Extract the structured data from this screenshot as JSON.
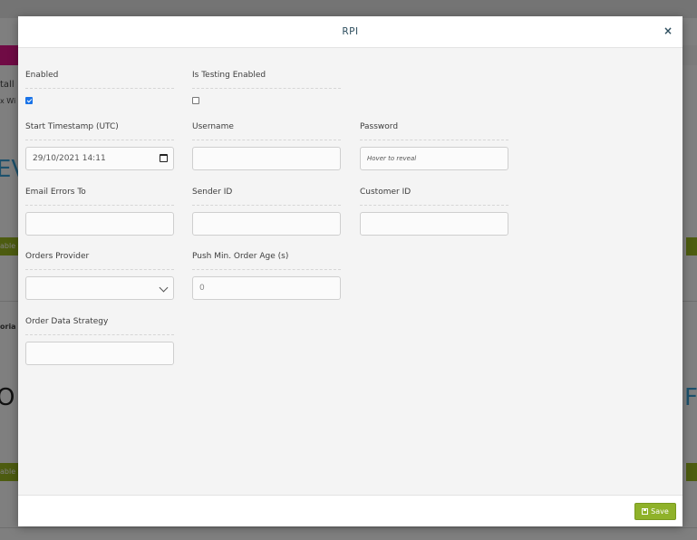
{
  "background": {
    "text_a": "tall",
    "text_b": "x Wi",
    "text_c": "oria",
    "big_left_1": "EV",
    "big_left_2": "O",
    "big_right_2": "F",
    "btn_left": "able",
    "btn_left_2": "able"
  },
  "modal": {
    "title": "RPI",
    "close_symbol": "×"
  },
  "form": {
    "enabled": {
      "label": "Enabled",
      "checked": true
    },
    "is_testing_enabled": {
      "label": "Is Testing Enabled",
      "checked": false
    },
    "start_timestamp": {
      "label": "Start Timestamp (UTC)",
      "value": "29/10/2021 14:11"
    },
    "username": {
      "label": "Username",
      "value": ""
    },
    "password": {
      "label": "Password",
      "placeholder": "Hover to reveal"
    },
    "email_errors_to": {
      "label": "Email Errors To",
      "value": ""
    },
    "sender_id": {
      "label": "Sender ID",
      "value": ""
    },
    "customer_id": {
      "label": "Customer ID",
      "value": ""
    },
    "orders_provider": {
      "label": "Orders Provider",
      "selected": ""
    },
    "push_min_order_age": {
      "label": "Push Min. Order Age (s)",
      "value": "0"
    },
    "order_data_strategy": {
      "label": "Order Data Strategy",
      "value": ""
    }
  },
  "footer": {
    "save_label": "Save",
    "save_icon": "floppy-disk-icon"
  },
  "colors": {
    "accent_green": "#8fb22a",
    "title_color": "#2f4f5f",
    "checkbox_blue": "#1a73e8"
  }
}
